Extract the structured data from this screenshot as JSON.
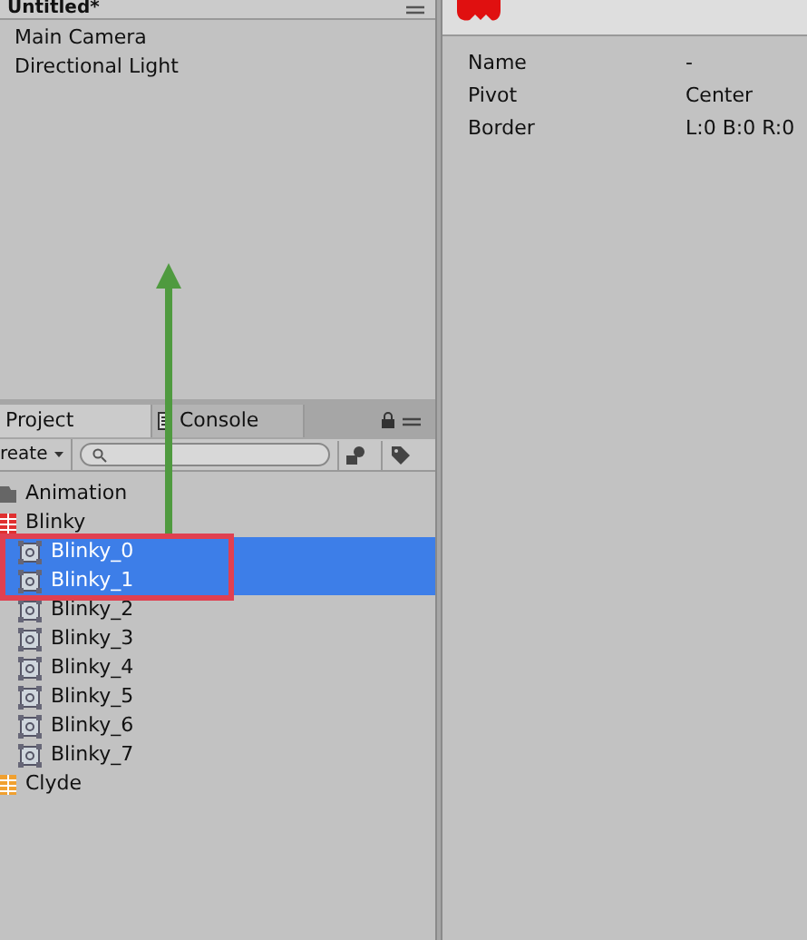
{
  "hierarchy": {
    "title": "Untitled*",
    "items": [
      {
        "label": "Main Camera"
      },
      {
        "label": "Directional Light"
      }
    ]
  },
  "tabs": [
    {
      "label": "Project",
      "kind": "project",
      "selected": true
    },
    {
      "label": "Console",
      "kind": "console",
      "selected": false
    }
  ],
  "toolbar": {
    "create": "reate"
  },
  "project_items": [
    {
      "label": "Animation",
      "kind": "folder",
      "selected": false
    },
    {
      "label": "Blinky",
      "kind": "sheet",
      "color": "#e03030",
      "selected": false,
      "children": [
        {
          "label": "Blinky_0",
          "kind": "sprite",
          "selected": true
        },
        {
          "label": "Blinky_1",
          "kind": "sprite",
          "selected": true
        },
        {
          "label": "Blinky_2",
          "kind": "sprite",
          "selected": false
        },
        {
          "label": "Blinky_3",
          "kind": "sprite",
          "selected": false
        },
        {
          "label": "Blinky_4",
          "kind": "sprite",
          "selected": false
        },
        {
          "label": "Blinky_5",
          "kind": "sprite",
          "selected": false
        },
        {
          "label": "Blinky_6",
          "kind": "sprite",
          "selected": false
        },
        {
          "label": "Blinky_7",
          "kind": "sprite",
          "selected": false
        }
      ]
    },
    {
      "label": "Clyde",
      "kind": "sheet",
      "color": "#f0a030",
      "selected": false
    }
  ],
  "inspector": {
    "properties": [
      {
        "name": "Name",
        "value": "-"
      },
      {
        "name": "Pivot",
        "value": "Center"
      },
      {
        "name": "Border",
        "value": "L:0 B:0 R:0"
      }
    ]
  }
}
